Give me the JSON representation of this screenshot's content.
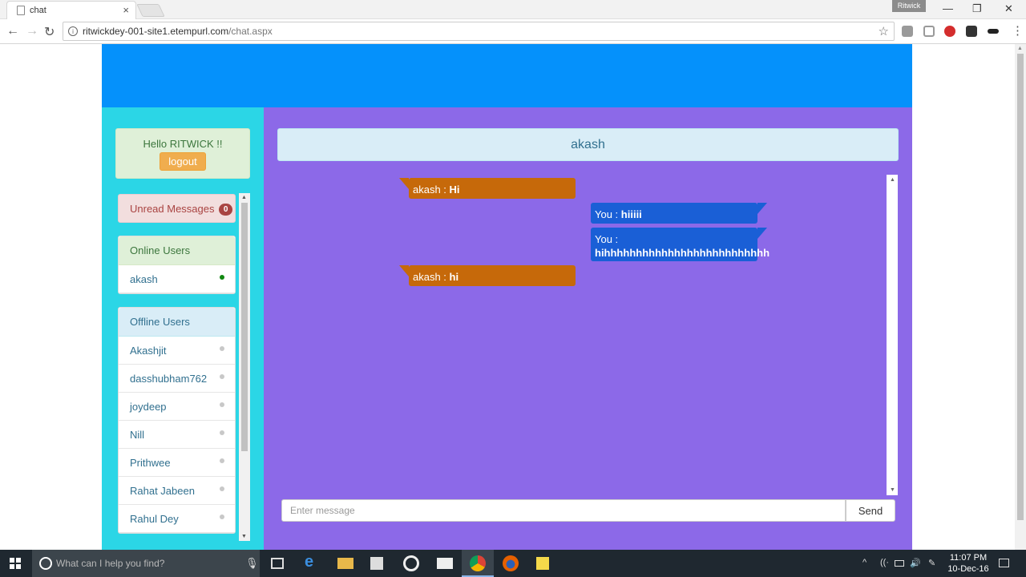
{
  "browser": {
    "tab_title": "chat",
    "tab_close": "×",
    "profile_name": "Ritwick",
    "url_host": "ritwickdey-001-site1.etempurl.com",
    "url_path": "/chat.aspx",
    "window_controls": [
      "—",
      "❐",
      "✕"
    ]
  },
  "sidebar": {
    "greeting": "Hello RITWICK !!",
    "logout_label": "logout",
    "unread_label": "Unread Messages",
    "unread_count": "0",
    "online_heading": "Online Users",
    "online_users": [
      "akash"
    ],
    "offline_heading": "Offline Users",
    "offline_users": [
      "Akashjit",
      "dasshubham762",
      "joydeep",
      "Nill",
      "Prithwee",
      "Rahat Jabeen",
      "Rahul Dey"
    ]
  },
  "chat": {
    "partner_name": "akash",
    "messages": [
      {
        "direction": "in",
        "sender": "akash :",
        "text": "Hi"
      },
      {
        "direction": "out",
        "sender": "You :",
        "text": "hiiiii"
      },
      {
        "direction": "out",
        "sender": "You :",
        "text": "hihhhhhhhhhhhhhhhhhhhhhhhhhh"
      },
      {
        "direction": "in",
        "sender": "akash :",
        "text": "hi"
      }
    ],
    "input_placeholder": "Enter message",
    "send_label": "Send"
  },
  "taskbar": {
    "search_placeholder": "What can I help you find?",
    "time": "11:07 PM",
    "date": "10-Dec-16"
  },
  "colors": {
    "header_blue": "#0591fb",
    "sidebar_cyan": "#2bd6e6",
    "chat_purple": "#8c69e8",
    "incoming_bubble": "#c6690a",
    "outgoing_bubble": "#1a5fd6"
  }
}
